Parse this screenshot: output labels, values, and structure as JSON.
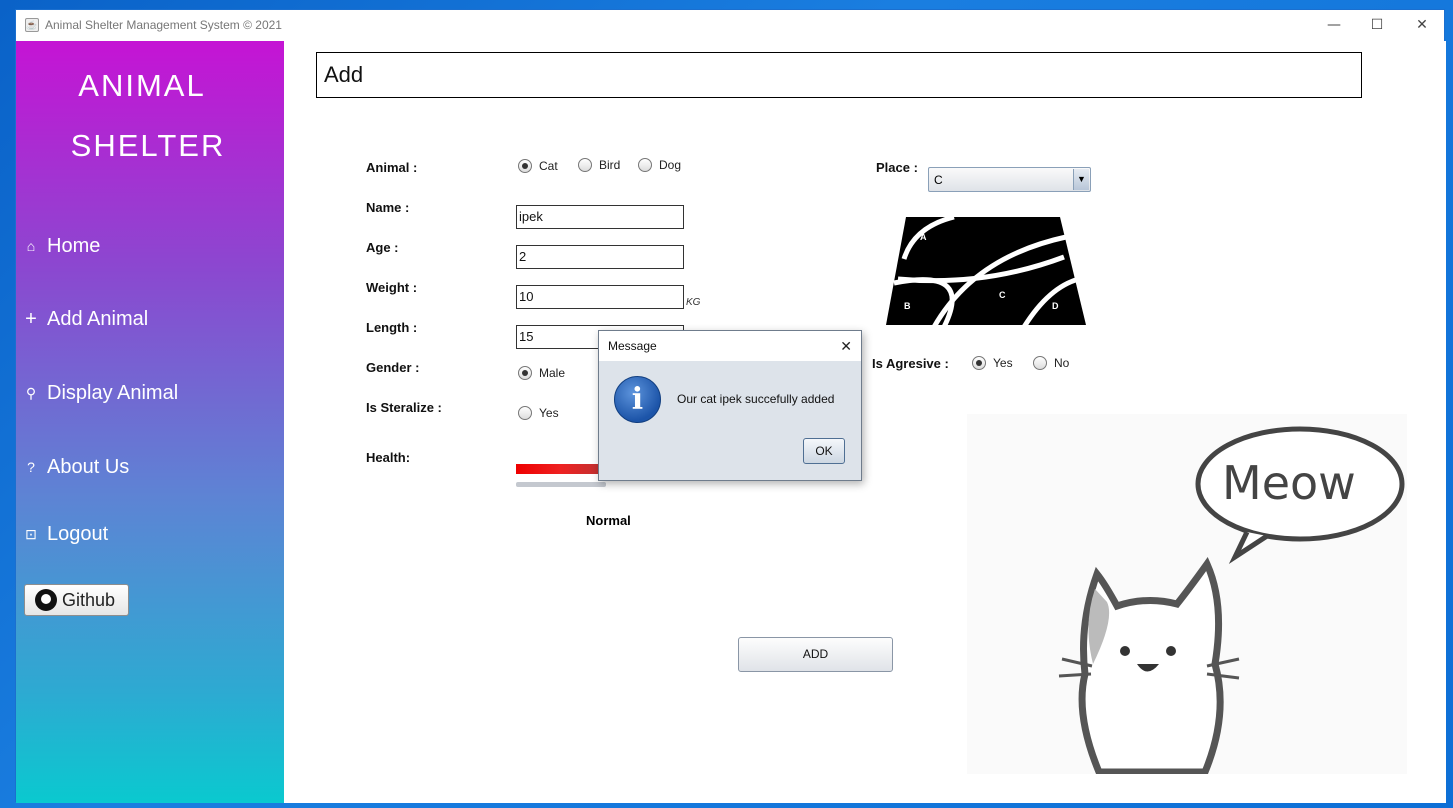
{
  "window": {
    "title": "Animal Shelter Management System © 2021"
  },
  "sidebar": {
    "brand_line1": "ANIMAL",
    "brand_line2": "SHELTER",
    "items": [
      {
        "label": "Home",
        "icon": "home-icon"
      },
      {
        "label": "Add Animal",
        "icon": "plus-icon"
      },
      {
        "label": "Display Animal",
        "icon": "wrench-icon"
      },
      {
        "label": "About Us",
        "icon": "question-icon"
      },
      {
        "label": "Logout",
        "icon": "logout-icon"
      }
    ],
    "github_label": "Github"
  },
  "main": {
    "page_title": "Add",
    "form": {
      "animal_label": "Animal :",
      "animal_options": [
        "Cat",
        "Bird",
        "Dog"
      ],
      "animal_selected": "Cat",
      "name_label": "Name :",
      "name_value": "ipek",
      "age_label": "Age :",
      "age_value": "2",
      "weight_label": "Weight :",
      "weight_value": "10",
      "weight_unit": "KG",
      "length_label": "Length :",
      "length_value": "15",
      "gender_label": "Gender :",
      "gender_option": "Male",
      "sterilize_label": "Is Steralize :",
      "sterilize_option": "Yes",
      "health_label": "Health:",
      "health_value": "Normal",
      "place_label": "Place :",
      "place_value": "C",
      "map_labels": [
        "A",
        "B",
        "C",
        "D"
      ],
      "aggressive_label": "Is Agresive :",
      "aggressive_options": [
        "Yes",
        "No"
      ],
      "aggressive_selected": "Yes",
      "add_button": "ADD"
    },
    "meow_text": "Meow"
  },
  "dialog": {
    "title": "Message",
    "message": "Our cat ipek succefully added",
    "ok_label": "OK"
  }
}
